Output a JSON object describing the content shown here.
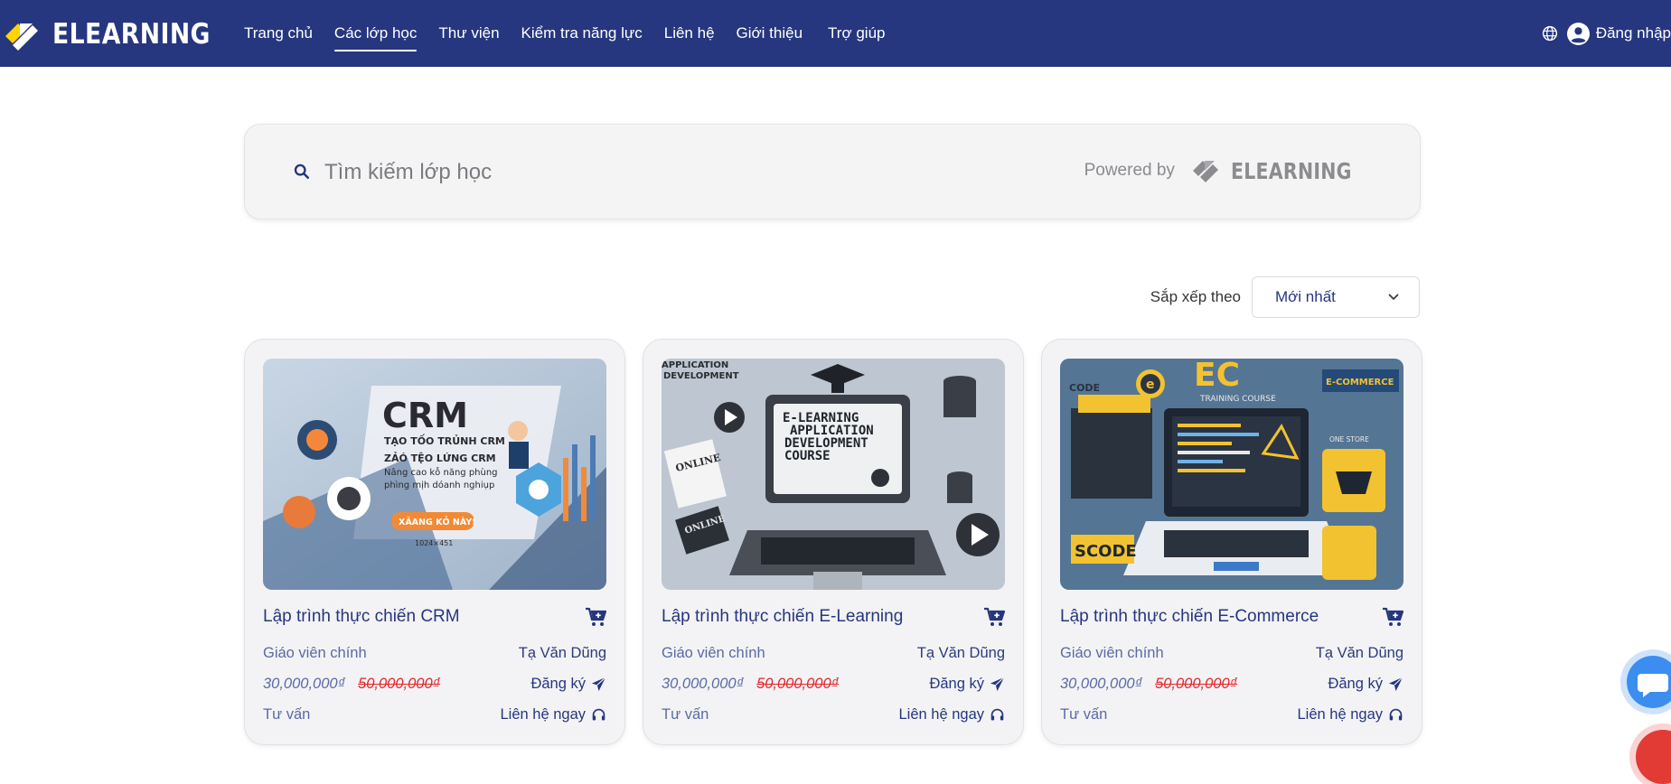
{
  "app": {
    "brand": "ELEARNING",
    "colors": {
      "primary": "#26367f",
      "accent": "#ffd400",
      "danger": "#e5252a"
    }
  },
  "nav": {
    "items": [
      {
        "label": "Trang chủ",
        "active": false
      },
      {
        "label": "Các lớp học",
        "active": true
      },
      {
        "label": "Thư viện",
        "active": false
      },
      {
        "label": "Kiểm tra năng lực",
        "active": false
      },
      {
        "label": "Liên hệ",
        "active": false
      },
      {
        "label": "Giới thiệu",
        "active": false
      },
      {
        "label": "Trợ giúp",
        "active": false
      }
    ],
    "login_label": "Đăng nhập",
    "globe_icon": "globe-icon",
    "user_icon": "user-circle-icon"
  },
  "search": {
    "placeholder": "Tìm kiếm lớp học",
    "powered_by_label": "Powered by",
    "powered_by_brand": "ELEARNING"
  },
  "sort": {
    "label": "Sắp xếp theo",
    "selected": "Mới nhất"
  },
  "courses": [
    {
      "title": "Lập trình thực chiến CRM",
      "thumbnail_text": [
        "CRM",
        "TẠO TỐO TRỦNH CRM",
        "ZẢÓ TỆO LỨNG CRM",
        "Nâng cao kỗ năng phùng",
        "phìng mịh dóanh nghiụp",
        "XĂANG KỎ NÀY!",
        "1024×451"
      ],
      "teacher_label": "Giáo viên chính",
      "teacher": "Tạ Văn Dũng",
      "price": "30,000,000₫",
      "old_price": "50,000,000₫",
      "register_label": "Đăng ký",
      "consult_label": "Tư vấn",
      "contact_label": "Liên hệ ngay"
    },
    {
      "title": "Lập trình thực chiến E-Learning",
      "thumbnail_text": [
        "APPLICATION",
        "DEVELOPMENT",
        "E-LEARNING",
        "APPLICATION",
        "DEVELOPMENT",
        "COURSE",
        "ONLINE",
        "ONLINE"
      ],
      "teacher_label": "Giáo viên chính",
      "teacher": "Tạ Văn Dũng",
      "price": "30,000,000₫",
      "old_price": "50,000,000₫",
      "register_label": "Đăng ký",
      "consult_label": "Tư vấn",
      "contact_label": "Liên hệ ngay"
    },
    {
      "title": "Lập trình thực chiến E-Commerce",
      "thumbnail_text": [
        "CODE",
        "e",
        "EC",
        "TRAINING COURSE",
        "E-COMMERCE",
        "ONE STORE",
        "SCODE"
      ],
      "teacher_label": "Giáo viên chính",
      "teacher": "Tạ Văn Dũng",
      "price": "30,000,000₫",
      "old_price": "50,000,000₫",
      "register_label": "Đăng ký",
      "consult_label": "Tư vấn",
      "contact_label": "Liên hệ ngay"
    }
  ]
}
